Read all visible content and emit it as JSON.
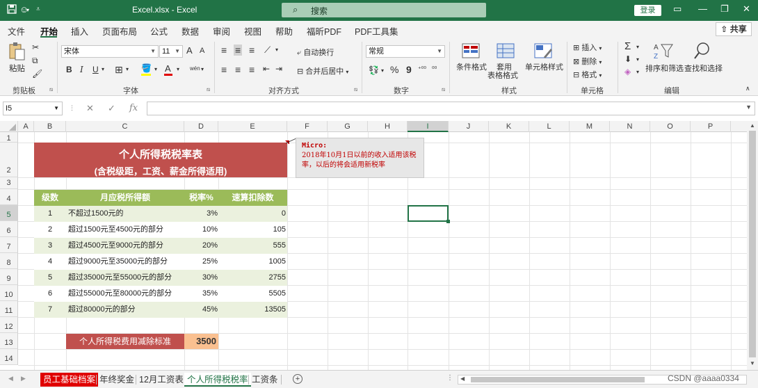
{
  "titlebar": {
    "filename": "Excel.xlsx  -  Excel",
    "search_placeholder": "搜索",
    "login": "登录"
  },
  "menu": {
    "tabs": [
      "文件",
      "开始",
      "插入",
      "页面布局",
      "公式",
      "数据",
      "审阅",
      "视图",
      "帮助",
      "福昕PDF",
      "PDF工具集"
    ],
    "share": "共享"
  },
  "ribbon": {
    "clipboard": {
      "paste": "粘贴",
      "label": "剪贴板"
    },
    "font": {
      "name": "宋体",
      "size": "11",
      "label": "字体",
      "bold": "B",
      "italic": "I",
      "underline": "U",
      "grow": "A",
      "shrink": "A"
    },
    "alignment": {
      "wrap": "自动换行",
      "merge": "合并后居中",
      "label": "对齐方式"
    },
    "number": {
      "format": "常规",
      "percent": "%",
      "comma": "9",
      "label": "数字"
    },
    "styles": {
      "conditional": "条件格式",
      "table_format_1": "套用",
      "table_format_2": "表格格式",
      "cell_styles": "单元格样式",
      "label": "样式"
    },
    "cells": {
      "insert": "插入",
      "delete": "删除",
      "format": "格式",
      "label": "单元格"
    },
    "editing": {
      "sort": "排序和筛选",
      "find": "查找和选择",
      "label": "编辑"
    }
  },
  "formula_bar": {
    "name_box": "I5",
    "fx": "fx",
    "value": ""
  },
  "columns": [
    "A",
    "B",
    "C",
    "D",
    "E",
    "F",
    "G",
    "H",
    "I",
    "J",
    "K",
    "L",
    "M",
    "N",
    "O",
    "P"
  ],
  "rows": [
    "1",
    "2",
    "3",
    "4",
    "5",
    "6",
    "7",
    "8",
    "9",
    "10",
    "11",
    "12",
    "13",
    "14"
  ],
  "sheet": {
    "title_line1": "个人所得税税率表",
    "title_line2": "(含税级距，工资、薪金所得适用)",
    "headers": [
      "级数",
      "月应税所得额",
      "税率%",
      "速算扣除数"
    ],
    "table": [
      {
        "level": "1",
        "range": "不超过1500元的",
        "rate": "3%",
        "deduction": "0"
      },
      {
        "level": "2",
        "range": "超过1500元至4500元的部分",
        "rate": "10%",
        "deduction": "105"
      },
      {
        "level": "3",
        "range": "超过4500元至9000元的部分",
        "rate": "20%",
        "deduction": "555"
      },
      {
        "level": "4",
        "range": "超过9000元至35000元的部分",
        "rate": "25%",
        "deduction": "1005"
      },
      {
        "level": "5",
        "range": "超过35000元至55000元的部分",
        "rate": "30%",
        "deduction": "2755"
      },
      {
        "level": "6",
        "range": "超过55000元至80000元的部分",
        "rate": "35%",
        "deduction": "5505"
      },
      {
        "level": "7",
        "range": "超过80000元的部分",
        "rate": "45%",
        "deduction": "13505"
      }
    ],
    "deduction_label": "个人所得税费用减除标准",
    "deduction_value": "3500",
    "comment_author": "Micro:",
    "comment_text": "2018年10月1日以前的收入适用该税率，以后的将会适用新税率"
  },
  "sheet_tabs": [
    "员工基础档案",
    "年终奖金",
    "12月工资表",
    "个人所得税税率",
    "工资条"
  ],
  "active_tab": "个人所得税税率",
  "watermark": "CSDN @aaaa0334",
  "colors": {
    "excel_green": "#217346",
    "title_red": "#c0504d",
    "header_green": "#9bbb59",
    "band_light": "#ebf1de",
    "deduction_orange": "#fac090",
    "comment_red": "#c00000"
  }
}
